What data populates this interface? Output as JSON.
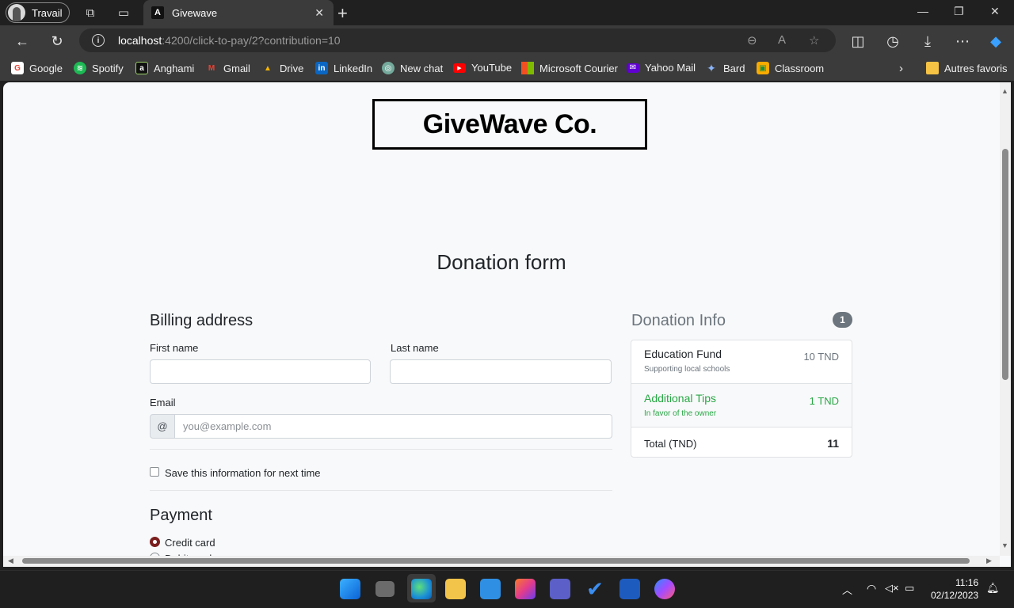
{
  "browser": {
    "profile_label": "Travail",
    "tab_title": "Givewave",
    "tab_favicon": "A",
    "url_host": "localhost",
    "url_path": ":4200/click-to-pay/2?contribution=10"
  },
  "favorites": [
    {
      "label": "Google",
      "icon": "google-icon",
      "color": "#ea4335",
      "glyph": "G"
    },
    {
      "label": "Spotify",
      "icon": "spotify-icon",
      "color": "#1db954",
      "glyph": "≋"
    },
    {
      "label": "Anghami",
      "icon": "anghami-icon",
      "color": "#111111",
      "glyph": "a"
    },
    {
      "label": "Gmail",
      "icon": "gmail-icon",
      "color": "#d93025",
      "glyph": "M"
    },
    {
      "label": "Drive",
      "icon": "drive-icon",
      "color": "#f4b400",
      "glyph": "▲"
    },
    {
      "label": "LinkedIn",
      "icon": "linkedin-icon",
      "color": "#0a66c2",
      "glyph": "in"
    },
    {
      "label": "New chat",
      "icon": "chatgpt-icon",
      "color": "#74aa9c",
      "glyph": "◎"
    },
    {
      "label": "YouTube",
      "icon": "youtube-icon",
      "color": "#ff0000",
      "glyph": "▶"
    },
    {
      "label": "Microsoft Courier",
      "icon": "microsoft-icon",
      "color": "#f25022",
      "glyph": "■"
    },
    {
      "label": "Yahoo Mail",
      "icon": "yahoo-mail-icon",
      "color": "#6001d2",
      "glyph": "✉"
    },
    {
      "label": "Bard",
      "icon": "bard-icon",
      "color": "#4285f4",
      "glyph": "✦"
    },
    {
      "label": "Classroom",
      "icon": "classroom-icon",
      "color": "#f9ab00",
      "glyph": "▣"
    }
  ],
  "favorites_other": "Autres favoris",
  "page": {
    "logo": "GiveWave Co.",
    "title": "Donation form",
    "billing_heading": "Billing address",
    "first_name_label": "First name",
    "last_name_label": "Last name",
    "email_label": "Email",
    "email_prefix": "@",
    "email_placeholder": "you@example.com",
    "save_info_label": "Save this information for next time",
    "payment_heading": "Payment",
    "payment_options": [
      "Credit card",
      "Debit card"
    ]
  },
  "donation": {
    "heading": "Donation Info",
    "count": "1",
    "items": [
      {
        "title": "Education Fund",
        "subtitle": "Supporting local schools",
        "amount": "10 TND"
      },
      {
        "title": "Additional Tips",
        "subtitle": "In favor of the owner",
        "amount": "1 TND"
      }
    ],
    "total_label": "Total (TND)",
    "total_value": "11"
  },
  "colors": {
    "accent_green": "#28a745",
    "radio_selected": "#7b1e1e"
  },
  "system": {
    "time": "11:16",
    "date": "02/12/2023"
  }
}
